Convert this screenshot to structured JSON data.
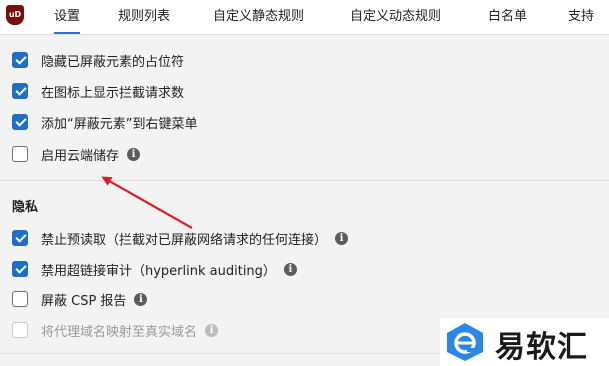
{
  "tabs": [
    {
      "label": "设置",
      "active": true
    },
    {
      "label": "规则列表",
      "active": false
    },
    {
      "label": "自定义静态规则",
      "active": false
    },
    {
      "label": "自定义动态规则",
      "active": false
    },
    {
      "label": "白名单",
      "active": false
    },
    {
      "label": "支持",
      "active": false
    }
  ],
  "logo": {
    "text": "uD"
  },
  "appearance": {
    "items": [
      {
        "label": "隐藏已屏蔽元素的占位符",
        "checked": true
      },
      {
        "label": "在图标上显示拦截请求数",
        "checked": true
      },
      {
        "label": "添加“屏蔽元素”到右键菜单",
        "checked": true
      },
      {
        "label": "启用云端储存",
        "checked": false,
        "info": "i"
      }
    ]
  },
  "privacy": {
    "title": "隐私",
    "items": [
      {
        "label": "禁止预读取（拦截对已屏蔽网络请求的任何连接）",
        "checked": true,
        "info": "i"
      },
      {
        "label": "禁用超链接审计（hyperlink auditing）",
        "checked": true,
        "info": "i"
      },
      {
        "label": "屏蔽 CSP 报告",
        "checked": false,
        "info": "i"
      },
      {
        "label": "将代理域名映射至真实域名",
        "checked": false,
        "disabled": true,
        "info": "i"
      }
    ]
  },
  "annotation": {
    "arrow_color": "#d6242b"
  },
  "watermark": {
    "text": "易软汇"
  },
  "colors": {
    "accent": "#1f6ec8",
    "tab_underline": "#2f6fd1"
  }
}
